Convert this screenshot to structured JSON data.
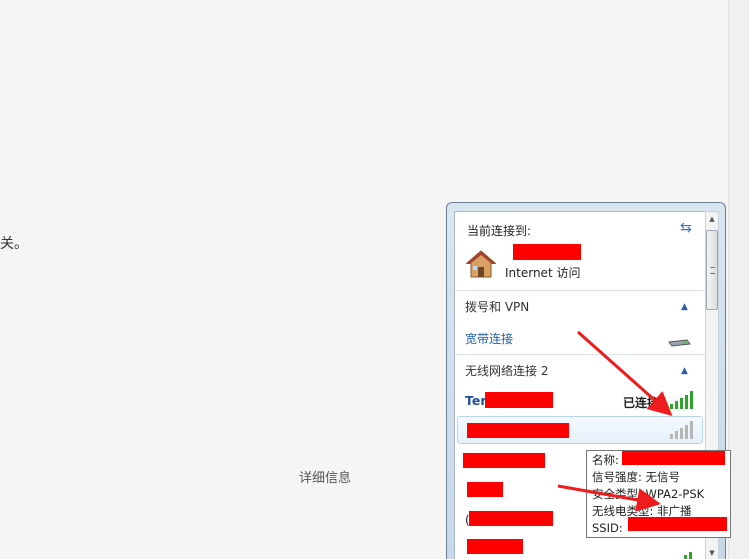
{
  "background": {
    "fragment_text": "关。",
    "details_link": "详细信息"
  },
  "flyout": {
    "header": {
      "title": "当前连接到:",
      "access_label": "Internet 访问"
    },
    "sections": [
      {
        "title": "拨号和 VPN",
        "item_label": "宽带连接"
      },
      {
        "title": "无线网络连接 2"
      }
    ],
    "connected_network": {
      "name_prefix": "Ter",
      "status": "已连接"
    }
  },
  "tooltip": {
    "name_label": "名称:",
    "signal": "信号强度: 无信号",
    "security": "安全类型: WPA2-PSK",
    "radio": "无线电类型: 非广播",
    "ssid_label": "SSID:"
  },
  "colors": {
    "accent": "#1f5fb2",
    "redaction": "#ff0000",
    "arrow": "#ee1c1c"
  }
}
